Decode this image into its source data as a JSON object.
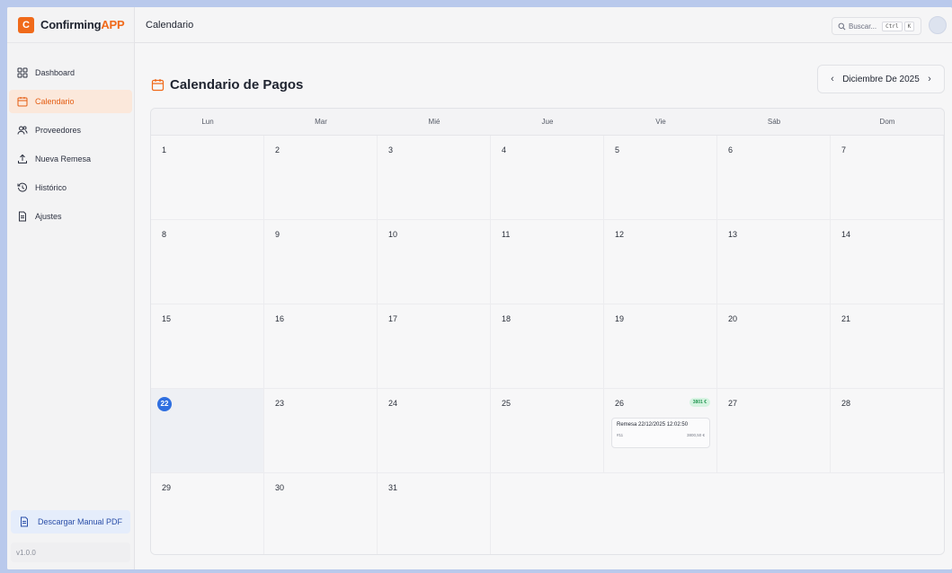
{
  "app": {
    "name_prefix": "Confirming",
    "name_accent": "APP",
    "logo_letter": "C",
    "version": "v1.0.0"
  },
  "sidebar": {
    "items": [
      {
        "label": "Dashboard",
        "icon": "grid-icon"
      },
      {
        "label": "Calendario",
        "icon": "calendar-icon",
        "active": true
      },
      {
        "label": "Proveedores",
        "icon": "users-icon"
      },
      {
        "label": "Nueva Remesa",
        "icon": "upload-icon"
      },
      {
        "label": "Histórico",
        "icon": "history-icon"
      },
      {
        "label": "Ajustes",
        "icon": "file-icon"
      }
    ],
    "download_label": "Descargar Manual PDF"
  },
  "topbar": {
    "title": "Calendario",
    "search_placeholder": "Buscar...",
    "shortcut_keys": [
      "Ctrl",
      "K"
    ]
  },
  "page": {
    "title": "Calendario de Pagos",
    "month_label": "Diciembre De 2025"
  },
  "calendar": {
    "weekdays": [
      "Lun",
      "Mar",
      "Mié",
      "Jue",
      "Vie",
      "Sáb",
      "Dom"
    ],
    "days": [
      "1",
      "2",
      "3",
      "4",
      "5",
      "6",
      "7",
      "8",
      "9",
      "10",
      "11",
      "12",
      "13",
      "14",
      "15",
      "16",
      "17",
      "18",
      "19",
      "20",
      "21",
      "22",
      "23",
      "24",
      "25",
      "26",
      "27",
      "28",
      "29",
      "30",
      "31"
    ],
    "today": "22",
    "event": {
      "day": "26",
      "badge": "3801 €",
      "title": "Remesa 22/12/2025 12:02:50",
      "id": "#11",
      "amount": "3800,50 €"
    }
  },
  "colors": {
    "accent": "#f06a1a",
    "today": "#2f6fe0",
    "badge_bg": "#d6f3e1",
    "badge_text": "#2a9a57"
  }
}
